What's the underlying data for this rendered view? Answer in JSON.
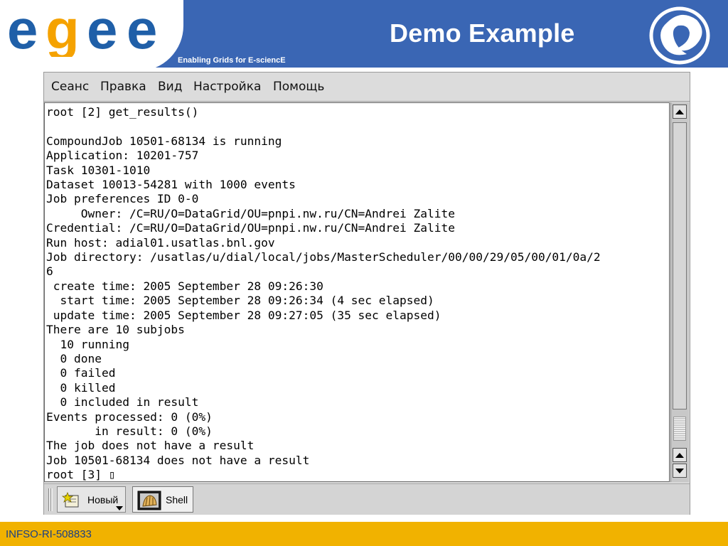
{
  "header": {
    "logo_text": "egee",
    "tagline": "Enabling Grids for E-sciencE",
    "title": "Demo Example",
    "colors": {
      "band": "#3a66b4",
      "logo_blue": "#1f5fa8",
      "logo_orange": "#f5a200"
    }
  },
  "terminal": {
    "menu": [
      "Сеанс",
      "Правка",
      "Вид",
      "Настройка",
      "Помощь"
    ],
    "lines": [
      "root [2] get_results()",
      "",
      "CompoundJob 10501-68134 is running",
      "Application: 10201-757",
      "Task 10301-1010",
      "Dataset 10013-54281 with 1000 events",
      "Job preferences ID 0-0",
      "     Owner: /C=RU/O=DataGrid/OU=pnpi.nw.ru/CN=Andrei Zalite",
      "Credential: /C=RU/O=DataGrid/OU=pnpi.nw.ru/CN=Andrei Zalite",
      "Run host: adial01.usatlas.bnl.gov",
      "Job directory: /usatlas/u/dial/local/jobs/MasterScheduler/00/00/29/05/00/01/0a/2",
      "6",
      " create time: 2005 September 28 09:26:30",
      "  start time: 2005 September 28 09:26:34 (4 sec elapsed)",
      " update time: 2005 September 28 09:27:05 (35 sec elapsed)",
      "There are 10 subjobs",
      "  10 running",
      "  0 done",
      "  0 failed",
      "  0 killed",
      "  0 included in result",
      "Events processed: 0 (0%)",
      "       in result: 0 (0%)",
      "The job does not have a result",
      "Job 10501-68134 does not have a result",
      "root [3] ▯"
    ],
    "tabs": [
      {
        "label": "Новый",
        "icon": "new-session-icon"
      },
      {
        "label": "Shell",
        "icon": "shell-icon"
      }
    ]
  },
  "footer": {
    "text": "INFSO-RI-508833",
    "color": "#f1b200"
  }
}
